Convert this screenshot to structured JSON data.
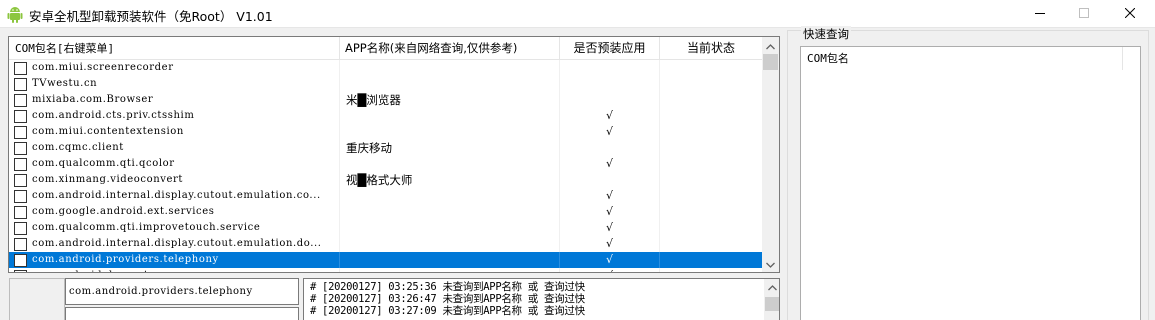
{
  "window": {
    "title": "安卓全机型卸载预装软件（免Root） V1.01",
    "icon": "android-icon",
    "controls": [
      "minimize-icon",
      "maximize-icon",
      "close-icon"
    ]
  },
  "package_list": {
    "columns": [
      "COM包名[右键菜单]",
      "APP名称(来自网络查询,仅供参考)",
      "是否预装应用",
      "当前状态"
    ],
    "rows": [
      {
        "package": "com.miui.screenrecorder",
        "app_name": "",
        "preinstalled": "",
        "status": "",
        "checked": false,
        "selected": false
      },
      {
        "package": "TVwestu.cn",
        "app_name": "",
        "preinstalled": "",
        "status": "",
        "checked": false,
        "selected": false
      },
      {
        "package": "mixiaba.com.Browser",
        "app_name": "米█浏览器",
        "preinstalled": "",
        "status": "",
        "checked": false,
        "selected": false
      },
      {
        "package": "com.android.cts.priv.ctsshim",
        "app_name": "",
        "preinstalled": "√",
        "status": "",
        "checked": false,
        "selected": false
      },
      {
        "package": "com.miui.contentextension",
        "app_name": "",
        "preinstalled": "√",
        "status": "",
        "checked": false,
        "selected": false
      },
      {
        "package": "com.cqmc.client",
        "app_name": "重庆移动",
        "preinstalled": "",
        "status": "",
        "checked": false,
        "selected": false
      },
      {
        "package": "com.qualcomm.qti.qcolor",
        "app_name": "",
        "preinstalled": "√",
        "status": "",
        "checked": false,
        "selected": false
      },
      {
        "package": "com.xinmang.videoconvert",
        "app_name": "视█格式大师",
        "preinstalled": "",
        "status": "",
        "checked": false,
        "selected": false
      },
      {
        "package": "com.android.internal.display.cutout.emulation.co...",
        "app_name": "",
        "preinstalled": "√",
        "status": "",
        "checked": false,
        "selected": false
      },
      {
        "package": "com.google.android.ext.services",
        "app_name": "",
        "preinstalled": "√",
        "status": "",
        "checked": false,
        "selected": false
      },
      {
        "package": "com.qualcomm.qti.improvetouch.service",
        "app_name": "",
        "preinstalled": "√",
        "status": "",
        "checked": false,
        "selected": false
      },
      {
        "package": "com.android.internal.display.cutout.emulation.do...",
        "app_name": "",
        "preinstalled": "√",
        "status": "",
        "checked": false,
        "selected": false
      },
      {
        "package": "com.android.providers.telephony",
        "app_name": "",
        "preinstalled": "√",
        "status": "",
        "checked": false,
        "selected": true
      },
      {
        "package": "com.android.dynsystem",
        "app_name": "",
        "preinstalled": "√",
        "status": "",
        "checked": false,
        "selected": false
      }
    ]
  },
  "selected_package_field": {
    "value": "com.android.providers.telephony"
  },
  "log": {
    "lines": [
      "# [20200127] 03:25:36 未查询到APP名称 或 查询过快",
      "# [20200127] 03:26:47 未查询到APP名称 或 查询过快",
      "# [20200127] 03:27:09 未查询到APP名称 或 查询过快"
    ]
  },
  "quick_query": {
    "legend": "快速查询",
    "column": "COM包名"
  },
  "colors": {
    "selection": "#0078d7",
    "window_bg": "#f0f0f0"
  }
}
